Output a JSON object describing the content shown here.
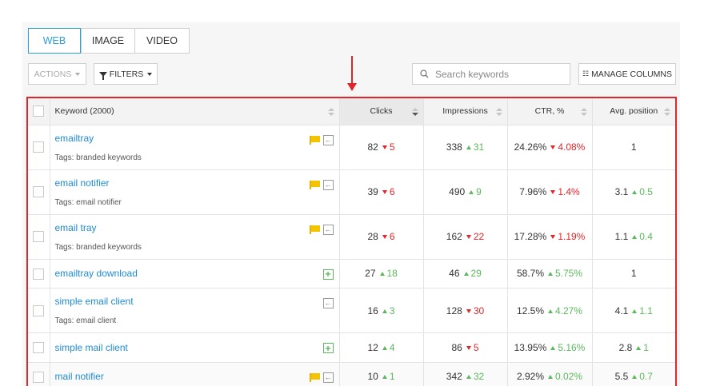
{
  "tabs": [
    {
      "label": "WEB",
      "active": true
    },
    {
      "label": "IMAGE",
      "active": false
    },
    {
      "label": "VIDEO",
      "active": false
    }
  ],
  "toolbar": {
    "actions_label": "ACTIONS",
    "filters_label": "FILTERS",
    "search_placeholder": "Search keywords",
    "manage_columns_label": "MANAGE COLUMNS"
  },
  "table": {
    "headers": {
      "keyword": "Keyword (2000)",
      "clicks": "Clicks",
      "impressions": "Impressions",
      "ctr": "CTR, %",
      "position": "Avg. position"
    },
    "rows": [
      {
        "keyword": "emailtray",
        "tags": "Tags: branded keywords",
        "flag": true,
        "icon": "arrow-left-icon",
        "clicks": "82",
        "clicks_delta": "5",
        "clicks_dir": "down",
        "impressions": "338",
        "impressions_delta": "31",
        "impressions_dir": "up",
        "ctr": "24.26%",
        "ctr_delta": "4.08%",
        "ctr_dir": "down",
        "position": "1",
        "position_delta": "",
        "position_dir": ""
      },
      {
        "keyword": "email notifier",
        "tags": "Tags: email notifier",
        "flag": true,
        "icon": "arrow-left-icon",
        "clicks": "39",
        "clicks_delta": "6",
        "clicks_dir": "down",
        "impressions": "490",
        "impressions_delta": "9",
        "impressions_dir": "up",
        "ctr": "7.96%",
        "ctr_delta": "1.4%",
        "ctr_dir": "down",
        "position": "3.1",
        "position_delta": "0.5",
        "position_dir": "up"
      },
      {
        "keyword": "email tray",
        "tags": "Tags: branded keywords",
        "flag": true,
        "icon": "arrow-left-icon",
        "clicks": "28",
        "clicks_delta": "6",
        "clicks_dir": "down",
        "impressions": "162",
        "impressions_delta": "22",
        "impressions_dir": "down",
        "ctr": "17.28%",
        "ctr_delta": "1.19%",
        "ctr_dir": "down",
        "position": "1.1",
        "position_delta": "0.4",
        "position_dir": "up"
      },
      {
        "keyword": "emailtray download",
        "tags": "",
        "flag": false,
        "icon": "plus-icon",
        "clicks": "27",
        "clicks_delta": "18",
        "clicks_dir": "up",
        "impressions": "46",
        "impressions_delta": "29",
        "impressions_dir": "up",
        "ctr": "58.7%",
        "ctr_delta": "5.75%",
        "ctr_dir": "up",
        "position": "1",
        "position_delta": "",
        "position_dir": ""
      },
      {
        "keyword": "simple email client",
        "tags": "Tags: email client",
        "flag": false,
        "icon": "arrow-left-icon",
        "clicks": "16",
        "clicks_delta": "3",
        "clicks_dir": "up",
        "impressions": "128",
        "impressions_delta": "30",
        "impressions_dir": "down",
        "ctr": "12.5%",
        "ctr_delta": "4.27%",
        "ctr_dir": "up",
        "position": "4.1",
        "position_delta": "1.1",
        "position_dir": "up"
      },
      {
        "keyword": "simple mail client",
        "tags": "",
        "flag": false,
        "icon": "plus-icon",
        "clicks": "12",
        "clicks_delta": "4",
        "clicks_dir": "up",
        "impressions": "86",
        "impressions_delta": "5",
        "impressions_dir": "down",
        "ctr": "13.95%",
        "ctr_delta": "5.16%",
        "ctr_dir": "up",
        "position": "2.8",
        "position_delta": "1",
        "position_dir": "up"
      },
      {
        "keyword": "mail notifier",
        "tags": "",
        "flag": true,
        "icon": "arrow-left-icon",
        "clicks": "10",
        "clicks_delta": "1",
        "clicks_dir": "up",
        "impressions": "342",
        "impressions_delta": "32",
        "impressions_dir": "up",
        "ctr": "2.92%",
        "ctr_delta": "0.02%",
        "ctr_dir": "up",
        "position": "5.5",
        "position_delta": "0.7",
        "position_dir": "up"
      }
    ]
  },
  "colors": {
    "accent": "#2a9fd6",
    "link": "#1f8bd1",
    "up": "#5cb85c",
    "down": "#e0262a",
    "highlight_border": "#e0262a"
  }
}
